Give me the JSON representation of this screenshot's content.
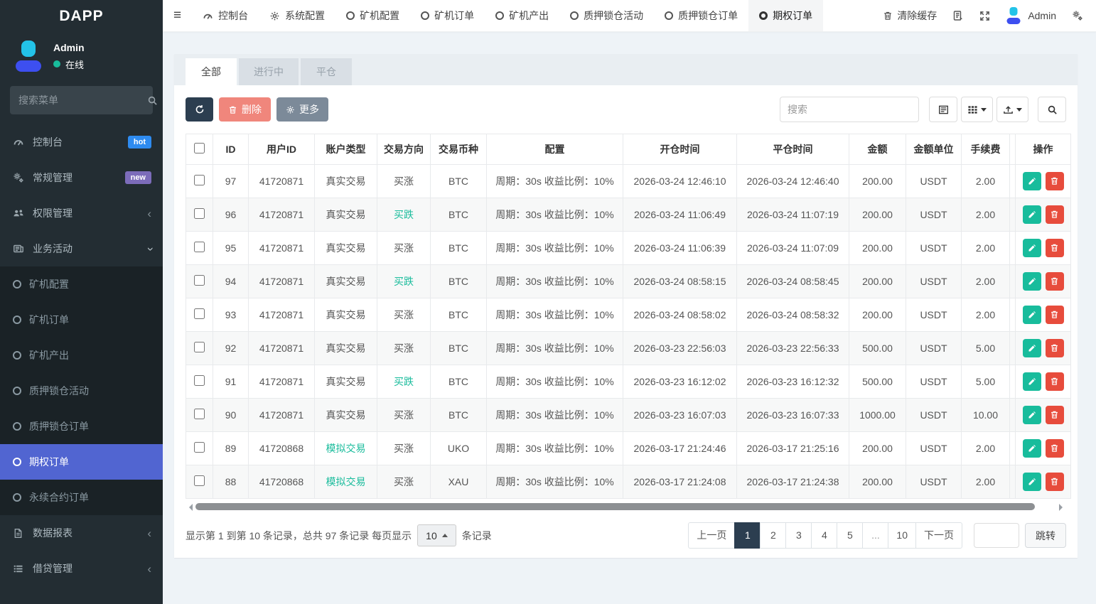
{
  "app": {
    "logo": "DAPP"
  },
  "sidebar": {
    "user": {
      "name": "Admin",
      "status": "在线"
    },
    "search_placeholder": "搜索菜单",
    "menu": [
      {
        "label": "控制台",
        "icon": "gauge-icon",
        "badge": "hot"
      },
      {
        "label": "常规管理",
        "icon": "gears-icon",
        "badge": "new"
      },
      {
        "label": "权限管理",
        "icon": "users-icon",
        "chevron": "left"
      },
      {
        "label": "业务活动",
        "icon": "briefcase-icon",
        "chevron": "down"
      }
    ],
    "submenu": [
      "矿机配置",
      "矿机订单",
      "矿机产出",
      "质押锁仓活动",
      "质押锁仓订单",
      "期权订单",
      "永续合约订单"
    ],
    "active_item": "期权订单",
    "menu_bottom": [
      {
        "label": "数据报表",
        "icon": "report-icon",
        "chevron": "left"
      },
      {
        "label": "借贷管理",
        "icon": "list-icon",
        "chevron": "left"
      }
    ]
  },
  "topbar": {
    "items": [
      {
        "label": "控制台",
        "icon": "gauge"
      },
      {
        "label": "系统配置",
        "icon": "gear"
      },
      {
        "label": "矿机配置",
        "icon": "circle"
      },
      {
        "label": "矿机订单",
        "icon": "circle"
      },
      {
        "label": "矿机产出",
        "icon": "circle"
      },
      {
        "label": "质押锁仓活动",
        "icon": "circle"
      },
      {
        "label": "质押锁仓订单",
        "icon": "circle"
      },
      {
        "label": "期权订单",
        "icon": "circle"
      }
    ],
    "active": "期权订单",
    "clear_cache": "清除缓存",
    "username": "Admin"
  },
  "tabs": {
    "items": [
      "全部",
      "进行中",
      "平仓"
    ],
    "active": "全部"
  },
  "toolbar": {
    "delete_label": "删除",
    "more_label": "更多",
    "search_placeholder": "搜索"
  },
  "table": {
    "columns": [
      "ID",
      "用户ID",
      "账户类型",
      "交易方向",
      "交易币种",
      "配置",
      "开仓时间",
      "平仓时间",
      "金额",
      "金额单位",
      "手续费",
      "操作"
    ],
    "rows": [
      {
        "id": "97",
        "user_id": "41720871",
        "account": "真实交易",
        "direction": "买涨",
        "coin": "BTC",
        "config": "周期：30s 收益比例：10%",
        "open_time": "2026-03-24 12:46:10",
        "close_time": "2026-03-24 12:46:40",
        "amount": "200.00",
        "unit": "USDT",
        "fee": "2.00"
      },
      {
        "id": "96",
        "user_id": "41720871",
        "account": "真实交易",
        "direction": "买跌",
        "coin": "BTC",
        "config": "周期：30s 收益比例：10%",
        "open_time": "2026-03-24 11:06:49",
        "close_time": "2026-03-24 11:07:19",
        "amount": "200.00",
        "unit": "USDT",
        "fee": "2.00"
      },
      {
        "id": "95",
        "user_id": "41720871",
        "account": "真实交易",
        "direction": "买涨",
        "coin": "BTC",
        "config": "周期：30s 收益比例：10%",
        "open_time": "2026-03-24 11:06:39",
        "close_time": "2026-03-24 11:07:09",
        "amount": "200.00",
        "unit": "USDT",
        "fee": "2.00"
      },
      {
        "id": "94",
        "user_id": "41720871",
        "account": "真实交易",
        "direction": "买跌",
        "coin": "BTC",
        "config": "周期：30s 收益比例：10%",
        "open_time": "2026-03-24 08:58:15",
        "close_time": "2026-03-24 08:58:45",
        "amount": "200.00",
        "unit": "USDT",
        "fee": "2.00"
      },
      {
        "id": "93",
        "user_id": "41720871",
        "account": "真实交易",
        "direction": "买涨",
        "coin": "BTC",
        "config": "周期：30s 收益比例：10%",
        "open_time": "2026-03-24 08:58:02",
        "close_time": "2026-03-24 08:58:32",
        "amount": "200.00",
        "unit": "USDT",
        "fee": "2.00"
      },
      {
        "id": "92",
        "user_id": "41720871",
        "account": "真实交易",
        "direction": "买涨",
        "coin": "BTC",
        "config": "周期：30s 收益比例：10%",
        "open_time": "2026-03-23 22:56:03",
        "close_time": "2026-03-23 22:56:33",
        "amount": "500.00",
        "unit": "USDT",
        "fee": "5.00"
      },
      {
        "id": "91",
        "user_id": "41720871",
        "account": "真实交易",
        "direction": "买跌",
        "coin": "BTC",
        "config": "周期：30s 收益比例：10%",
        "open_time": "2026-03-23 16:12:02",
        "close_time": "2026-03-23 16:12:32",
        "amount": "500.00",
        "unit": "USDT",
        "fee": "5.00"
      },
      {
        "id": "90",
        "user_id": "41720871",
        "account": "真实交易",
        "direction": "买涨",
        "coin": "BTC",
        "config": "周期：30s 收益比例：10%",
        "open_time": "2026-03-23 16:07:03",
        "close_time": "2026-03-23 16:07:33",
        "amount": "1000.00",
        "unit": "USDT",
        "fee": "10.00"
      },
      {
        "id": "89",
        "user_id": "41720868",
        "account": "模拟交易",
        "direction": "买涨",
        "coin": "UKO",
        "config": "周期：30s 收益比例：10%",
        "open_time": "2026-03-17 21:24:46",
        "close_time": "2026-03-17 21:25:16",
        "amount": "200.00",
        "unit": "USDT",
        "fee": "2.00"
      },
      {
        "id": "88",
        "user_id": "41720868",
        "account": "模拟交易",
        "direction": "买涨",
        "coin": "XAU",
        "config": "周期：30s 收益比例：10%",
        "open_time": "2026-03-17 21:24:08",
        "close_time": "2026-03-17 21:24:38",
        "amount": "200.00",
        "unit": "USDT",
        "fee": "2.00"
      }
    ],
    "accent_green": "#1abc9c",
    "sim_account_value": "模拟交易",
    "down_direction_value": "买跌"
  },
  "footer": {
    "info_prefix": "显示第 1 到第 10 条记录，总共 97 条记录 每页显示",
    "page_size": "10",
    "info_suffix": "条记录",
    "pages": [
      "上一页",
      "1",
      "2",
      "3",
      "4",
      "5",
      "...",
      "10",
      "下一页"
    ],
    "active_page": "1",
    "jump_label": "跳转"
  },
  "colors": {
    "sidebar_active": "#5165d1",
    "primary_dark": "#2c3e50",
    "success": "#18bc9c",
    "danger": "#e74c3c",
    "badge_hot": "#2e8bf0",
    "badge_new": "#7c6cba"
  }
}
